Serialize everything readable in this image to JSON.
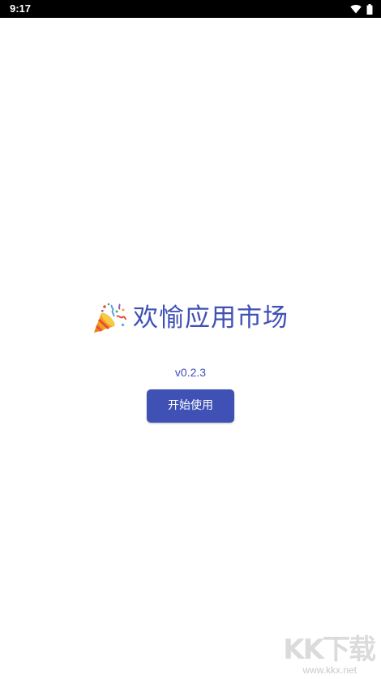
{
  "status_bar": {
    "time": "9:17",
    "icons": [
      "wifi-icon",
      "battery-icon"
    ]
  },
  "app": {
    "icon": "party-popper-icon",
    "title": "欢愉应用市场",
    "version": "v0.2.3",
    "start_button_label": "开始使用"
  },
  "watermark": {
    "logo": "KK下载",
    "url": "www.kkx.net"
  },
  "colors": {
    "accent": "#3f51b5",
    "background": "#ffffff",
    "status_bar": "#000000"
  }
}
